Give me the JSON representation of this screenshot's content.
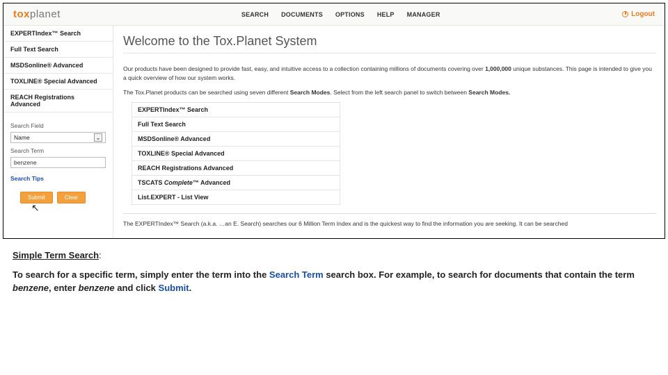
{
  "brand": {
    "tox": "tox",
    "planet": "planet"
  },
  "nav": {
    "search": "SEARCH",
    "documents": "DOCUMENTS",
    "options": "OPTIONS",
    "help": "HELP",
    "manager": "MANAGER",
    "logout": "Logout"
  },
  "sidebar": {
    "modes": {
      "expert": "EXPERTIndex™ Search",
      "fulltext": "Full Text Search",
      "msds": "MSDSonline® Advanced",
      "toxline": "TOXLINE® Special Advanced",
      "reach": "REACH Registrations Advanced"
    },
    "field_label": "Search Field",
    "field_value": "Name",
    "term_label": "Search Term",
    "term_value": "benzene",
    "tips": "Search Tips",
    "submit": "Submit",
    "clear": "Clear"
  },
  "main": {
    "welcome": "Welcome to the Tox.Planet System",
    "p1a": "Our products have been designed to provide fast, easy, and intuitive access to a collection containing millions of documents covering over ",
    "p1b": "1,000,000",
    "p1c": " unique substances. This page is intended to give you a quick overview of how our system works.",
    "p2a": "The Tox.Planet products can be searched using seven different ",
    "p2b": "Search Modes",
    "p2c": ". Select from the left search panel to switch between ",
    "p2d": "Search Modes.",
    "table": {
      "r1": "EXPERTIndex™ Search",
      "r2": "Full Text Search",
      "r3": "MSDSonline® Advanced",
      "r4": "TOXLINE® Special Advanced",
      "r5": "REACH Registrations Advanced",
      "r6a": "TSCATS ",
      "r6b": "Complete",
      "r6c": "™ Advanced",
      "r7": "List.EXPERT - List View"
    },
    "p3": "The EXPERTIndex™ Search (a.k.a. …an E. Search) searches our 6 Million Term Index and is the quickest way to find the information you are seeking. It can be searched"
  },
  "caption": {
    "title": "Simple Term Search",
    "colon": ":",
    "t1": "To search for a specific term, simply enter the term into the ",
    "t2": "Search Term",
    "t3": " search box.  For example, to search for documents that contain the term ",
    "t4": "benzene",
    "t5": ", enter ",
    "t6": "benzene",
    "t7": " and click ",
    "t8": "Submit",
    "t9": "."
  }
}
